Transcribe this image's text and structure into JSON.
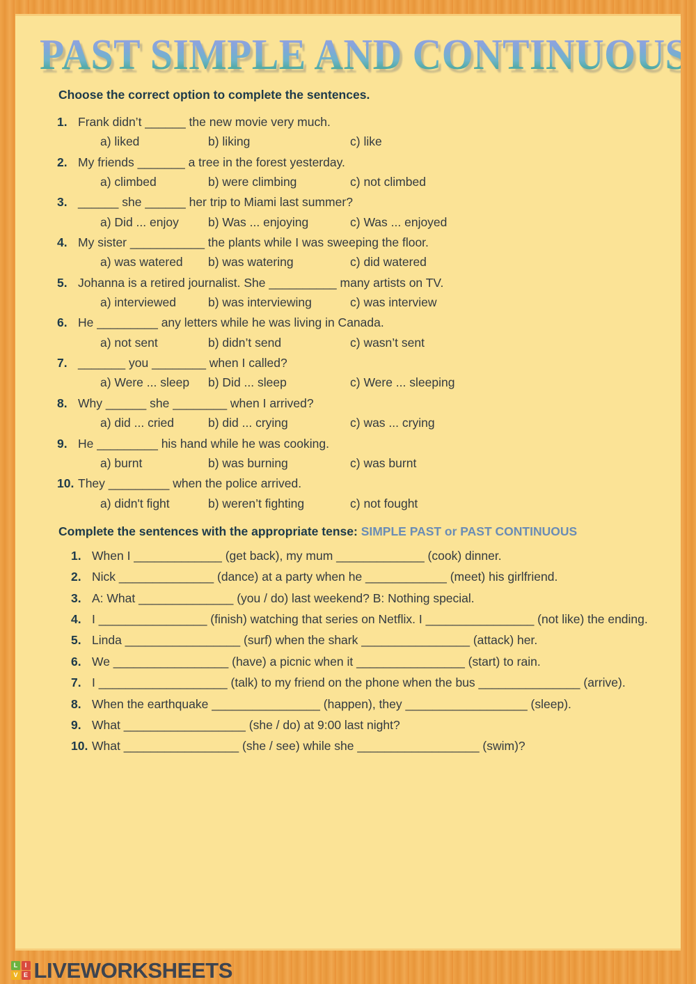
{
  "colors": {
    "border": "#ED9D3C",
    "page_background": "#FBE396",
    "heading": "#1D3A4A",
    "body_text": "#333A40",
    "accent_blue": "#6A8CB5",
    "title_gradient_top": "#A9B4E8",
    "title_gradient_bottom": "#33998C"
  },
  "title": "PAST SIMPLE AND CONTINUOUS",
  "section1": {
    "heading": "Choose the correct option to complete the sentences.",
    "questions": [
      {
        "number": "1.",
        "text": "Frank didn’t ______ the new movie very much.",
        "options": [
          "a)  liked",
          "b) liking",
          "c) like"
        ]
      },
      {
        "number": "2.",
        "text": "My friends _______ a tree in the forest yesterday.",
        "options": [
          "a)  climbed",
          "b) were climbing",
          "c) not climbed"
        ]
      },
      {
        "number": "3.",
        "text": "______ she ______ her trip to Miami last summer?",
        "options": [
          "a)  Did ... enjoy",
          "b) Was ... enjoying",
          "c) Was ... enjoyed"
        ]
      },
      {
        "number": "4.",
        "text": "My sister ___________ the plants while I was sweeping the floor.",
        "options": [
          "a)  was watered",
          "b) was watering",
          "c) did watered"
        ]
      },
      {
        "number": "5.",
        "text": "Johanna is a retired journalist. She __________ many artists on TV.",
        "options": [
          "a)  interviewed",
          "b) was interviewing",
          "c) was interview"
        ]
      },
      {
        "number": "6.",
        "text": "He _________ any letters while he was living in Canada.",
        "options": [
          "a)  not sent",
          "b) didn’t send",
          "c) wasn’t sent"
        ]
      },
      {
        "number": "7.",
        "text": "_______ you ________ when I called?",
        "options": [
          "a)  Were ... sleep",
          "b) Did ... sleep",
          "c) Were ... sleeping"
        ]
      },
      {
        "number": "8.",
        "text": "Why ______ she ________ when I arrived?",
        "options": [
          "a)  did ... cried",
          "b) did ... crying",
          "c) was ... crying"
        ]
      },
      {
        "number": "9.",
        "text": "He _________ his hand while he was cooking.",
        "options": [
          "a)  burnt",
          "b) was burning",
          "c) was burnt"
        ]
      },
      {
        "number": "10.",
        "text": "They _________ when the police arrived.",
        "options": [
          "a)  didn't fight",
          "b) weren’t fighting",
          "c) not fought"
        ]
      }
    ]
  },
  "section2": {
    "heading_plain": "Complete the sentences with the appropriate tense:",
    "heading_accent": "SIMPLE PAST or PAST CONTINUOUS",
    "items": [
      {
        "number": "1.",
        "text": "When I _____________ (get back), my mum _____________ (cook) dinner."
      },
      {
        "number": "2.",
        "text": "Nick ______________ (dance) at a party when he ____________ (meet) his girlfriend."
      },
      {
        "number": "3.",
        "text": "A: What ______________ (you / do) last weekend?   B: Nothing special."
      },
      {
        "number": "4.",
        "text": "I ________________ (finish) watching that series on Netflix. I ________________ (not like) the ending."
      },
      {
        "number": "5.",
        "text": "Linda _________________ (surf) when the shark ________________ (attack) her."
      },
      {
        "number": "6.",
        "text": "We _________________ (have) a picnic when it ________________ (start) to rain."
      },
      {
        "number": "7.",
        "text": "I ___________________ (talk) to my friend on the phone when the bus _______________ (arrive)."
      },
      {
        "number": "8.",
        "text": "When the earthquake ________________ (happen), they __________________ (sleep)."
      },
      {
        "number": "9.",
        "text": "What __________________ (she / do) at 9:00 last night?"
      },
      {
        "number": "10.",
        "text": "What _________________ (she / see) while she __________________ (swim)?"
      }
    ]
  },
  "footer": {
    "logo_tiles": [
      "L",
      "I",
      "V",
      "E"
    ],
    "logo_word": "LIVEWORKSHEETS"
  }
}
